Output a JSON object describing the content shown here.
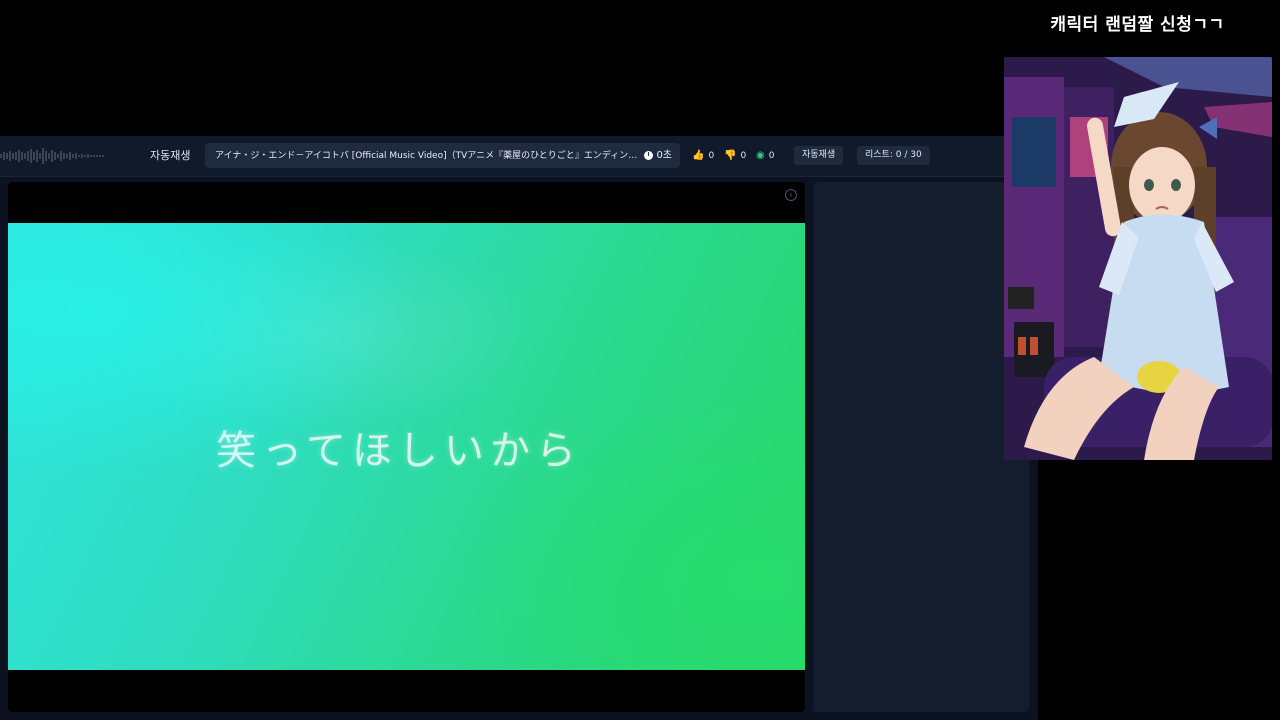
{
  "overlay": {
    "title": "캐릭터 랜덤짤 신청ㄱㄱ"
  },
  "topbar": {
    "autoplay_label": "자동재생",
    "track_title": "アイナ・ジ・エンド－アイコトバ [Official Music Video]（TVアニメ『薬屋のひとりごと』エンディングテ…",
    "duration": "0초",
    "likes": "0",
    "dislikes": "0",
    "views": "0",
    "autoplay_button": "자동재생",
    "list_button": "리스트: 0 / 30"
  },
  "video": {
    "lyric": "笑ってほしいから"
  },
  "icons": {
    "waveform": "waveform-icon",
    "clock": "clock-icon",
    "like": "thumbs-up-icon",
    "dislike": "thumbs-down-icon",
    "views": "eye-icon",
    "info": "info-icon"
  },
  "colors": {
    "page_bg": "#000000",
    "panel_bg": "#111a2b",
    "pill_bg": "#1e2a3e",
    "like": "#4a8cf0",
    "dislike": "#e0506a",
    "views": "#3cc98a"
  }
}
